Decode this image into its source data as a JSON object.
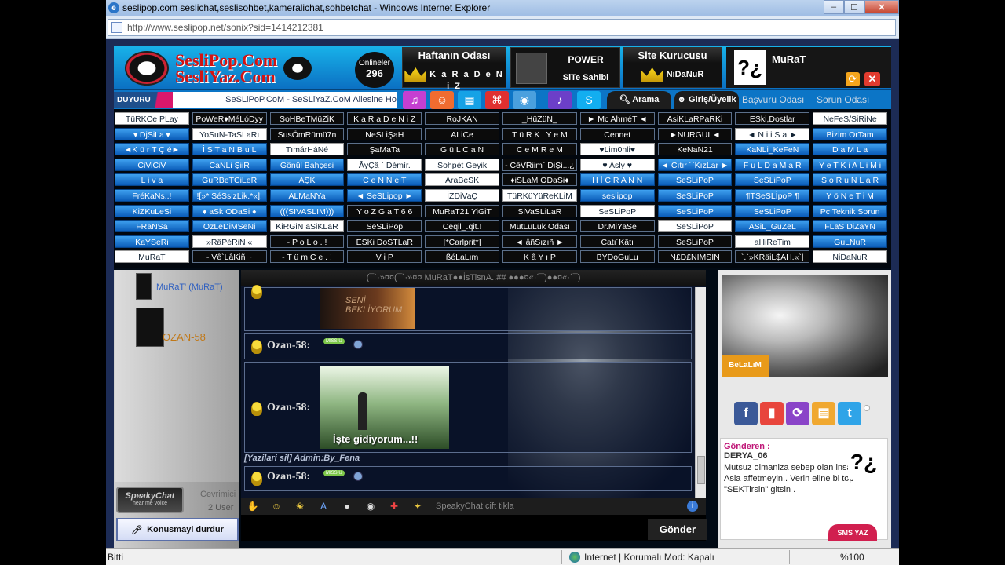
{
  "window": {
    "title": "seslipop.com seslichat,seslisohbet,kameralichat,sohbetchat - Windows Internet Explorer",
    "url": "http://www.seslipop.net/sonix?sid=1414212381"
  },
  "header": {
    "logo_line1": "SesliPop.Com",
    "logo_line2": "SesliYaz.Com",
    "online_label": "Onlineler",
    "online_count": "296",
    "haftanin_title": "Haftanın Odası",
    "haftanin_value": "K a R a D e N i Z",
    "power_title": "POWER",
    "power_sub": "SiTe Sahibi",
    "kurucu_title": "Site Kurucusu",
    "kurucu_value": "NiDaNuR",
    "user_name": "MuRaT"
  },
  "nav": {
    "duyuru": "DUYURU",
    "marquee": "SeSLiPoP.CoM - SeSLiYaZ.CoM Ailesine Ho",
    "arama": "Arama",
    "giris": "Giriş/Üyelik",
    "basvuru": "Başvuru Odası",
    "sorun": "Sorun Odası"
  },
  "rooms": [
    [
      "TüRKCe PLay",
      "PoWeR♦MéLóDyy",
      "SoHBeTMüZiK",
      "K a R a D e N i Z",
      "RoJKAN",
      "_HüZüN_",
      "► Mc AhméT ◄",
      "AsiKLaRPaRKi",
      "ESki,Dostlar",
      "NeFeS/SiRiNe"
    ],
    [
      "▼DjSiLa▼",
      "YoSuN-TaSLaRı",
      "SusÖmRümü7n",
      "NeSLiŞaH",
      "ALiCe",
      "T ü R K i Y e M",
      "Cennet",
      "►NURGUL◄",
      "◄ N i i S a ►",
      "Bizim OrTam"
    ],
    [
      "◄K ü r T Ç é►",
      "İ S T a N B u L",
      "TımárHáNé",
      "ŞaMaTa",
      "G ü L C a N",
      "C e M R e M",
      "♥Lim0nli♥",
      "KeNaN21",
      "KaNLi_KeFeN",
      "D a M L a"
    ],
    [
      "CiViCiV",
      "CaNLi ŞiiR",
      "Gönül Bahçesi",
      "ÂyÇâ ` Dèmír.",
      "Sohpét Geyik",
      "- CêVRiim` DiŞi...¿",
      "♥ Asly ♥",
      "◄ Cıtır ´`KızLar ►",
      "F u L D a M a R",
      "Y e T K i A L i M i"
    ],
    [
      "L i v a",
      "GuRBeTCiLeR",
      "AŞK",
      "C e N N e T",
      "AraBeSK",
      "♦iSLaM ODaSi♦",
      "H İ C R A N N",
      "SeSLiPoP",
      "SeSLiPoP",
      "S o R u N L a R"
    ],
    [
      "FréKaNs..!",
      "![»* SéSsizLik.*«]!",
      "ALMaNYa",
      "◄ SeSLipop ►",
      "İZDiVaÇ",
      "TüRKüYüReKLiM",
      "seslipop",
      "SeSLiPoP",
      "¶TSeSLİpoP ¶",
      "Y ö N e T i M"
    ],
    [
      "KiZKuLeSi",
      "♦ aSk ODaSi ♦",
      "(((SIVASLIM)))",
      "Y o Z G a T 6 6",
      "MuRaT21 YiGiT",
      "SiVaSLiLaR",
      "SeSLiPoP",
      "SeSLiPoP",
      "SeSLiPoP",
      "Pc Teknik Sorun"
    ],
    [
      "FRaNSa",
      "OzLeDiMSeNi",
      "KiRGiN aSiKLaR",
      "SeSLiPop",
      "Ceqil_.qit.!",
      "MutLuLuk Odası",
      "Dr.MiYaSe",
      "SeSLiPoP",
      "ASiL_GüZeL",
      "FLaS DiZaYN"
    ],
    [
      "KaYSeRi",
      "»RâPèRiN «",
      "- P o L o . !",
      "ESKi DoSTLaR",
      "[*Carlprit*]",
      "◄ åñSızıñ ►",
      "Catı´Kâtı",
      "SeSLiPoP",
      "aHiReTim",
      "GuLNuR"
    ],
    [
      "MuRaT",
      "- Vê`LâKiñ ~",
      "- T ü m C e . !",
      "V i P",
      "ßéLaLım",
      "K â Y ı P",
      "BYDoGuLu",
      "N£D£NIMSIN",
      "`.`»KRäiL$AH.«`|",
      "NiDaNuR"
    ]
  ],
  "room_styles": [
    [
      "w",
      "b",
      "b",
      "b",
      "b",
      "b",
      "b",
      "b",
      "b",
      "w"
    ],
    [
      "l",
      "w",
      "b",
      "b",
      "b",
      "b",
      "b",
      "b",
      "w",
      "l"
    ],
    [
      "l",
      "l",
      "w",
      "b",
      "b",
      "b",
      "w",
      "b",
      "l",
      "l"
    ],
    [
      "l",
      "l",
      "l",
      "w",
      "w",
      "b",
      "w",
      "l",
      "l",
      "l"
    ],
    [
      "l",
      "l",
      "l",
      "l",
      "w",
      "b",
      "l",
      "l",
      "l",
      "l"
    ],
    [
      "l",
      "l",
      "l",
      "l",
      "w",
      "w",
      "l",
      "l",
      "l",
      "l"
    ],
    [
      "l",
      "l",
      "l",
      "b",
      "b",
      "b",
      "w",
      "l",
      "l",
      "l"
    ],
    [
      "l",
      "l",
      "w",
      "b",
      "b",
      "b",
      "b",
      "w",
      "l",
      "l"
    ],
    [
      "l",
      "w",
      "b",
      "b",
      "b",
      "b",
      "b",
      "b",
      "w",
      "l"
    ],
    [
      "w",
      "b",
      "b",
      "b",
      "b",
      "b",
      "b",
      "b",
      "b",
      "w"
    ]
  ],
  "users": {
    "user1": "MuRaT' (MuRaT)",
    "user2": "OZAN-58"
  },
  "left": {
    "speaky_brand": "SpeakyChat",
    "speaky_tag": "hear me voice",
    "cevrimici": "Cevrimici",
    "user_count": "2 User",
    "konusmayi": "Konusmayi durdur"
  },
  "chat": {
    "header": "(¯`·»¤¤(¯`·»¤¤ MuRaT●●İsTisnA..## ●●●¤«·´¯)●●¤«·´¯)",
    "img1_text": "SENİ BEKLİYORUM",
    "nick": "Ozan-58:",
    "miss": "MISS U",
    "img2_caption": "İşte gidiyorum...!!",
    "admin_line": "[Yazilari sil] Admin:By_Fena",
    "cift": "SpeakyChat cift tikla",
    "send": "Gönder"
  },
  "right": {
    "belalim": "BeLaLıM",
    "gonderen_label": "Gönderen :",
    "gonderen_user": "DERYA_06",
    "gonderen_msg": "Mutsuz olmaniza sebep olan insanlari , Asla affetmeyin.. Verin eline bi top \"SEKTirsin\" gitsin .",
    "sms": "SMS YAZ"
  },
  "status": {
    "left": "Bitti",
    "zone": "Internet | Korumalı Mod: Kapalı",
    "zoom": "%100"
  },
  "colors": {
    "brand_red": "#d31313",
    "nav_blue": "#0c75c6",
    "room_blue": "#0a5cb8"
  }
}
